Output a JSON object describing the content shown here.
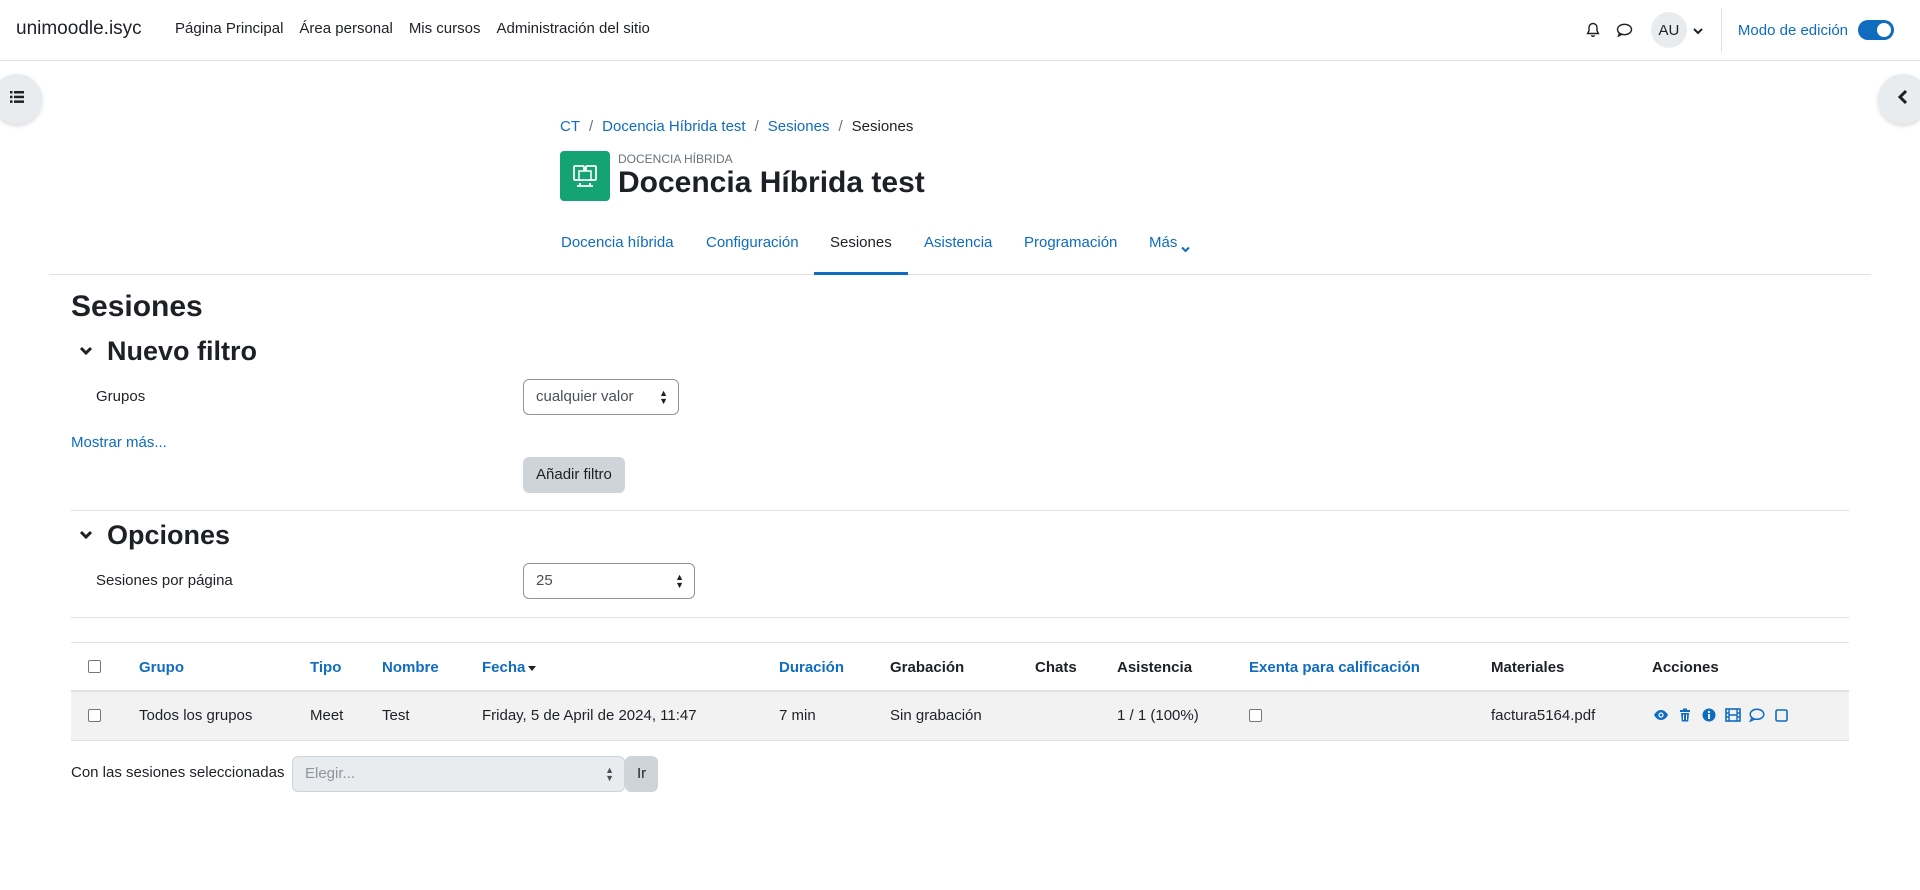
{
  "navbar": {
    "brand": "unimoodle.isyc",
    "links": [
      "Página Principal",
      "Área personal",
      "Mis cursos",
      "Administración del sitio"
    ],
    "user_initials": "AU",
    "edit_mode_label": "Modo de edición",
    "edit_mode_on": true
  },
  "breadcrumb": {
    "items": [
      "CT",
      "Docencia Híbrida test",
      "Sesiones"
    ],
    "current": "Sesiones"
  },
  "header": {
    "pretitle": "DOCENCIA HÍBRIDA",
    "title": "Docencia Híbrida test",
    "icon_color": "#16a374"
  },
  "secondary_nav": {
    "tabs": [
      "Docencia híbrida",
      "Configuración",
      "Sesiones",
      "Asistencia",
      "Programación",
      "Más"
    ],
    "active": "Sesiones"
  },
  "main": {
    "heading": "Sesiones",
    "filter": {
      "title": "Nuevo filtro",
      "groups_label": "Grupos",
      "groups_value": "cualquier valor",
      "show_more": "Mostrar más...",
      "add_filter": "Añadir filtro"
    },
    "options": {
      "title": "Opciones",
      "per_page_label": "Sesiones por página",
      "per_page_value": "25"
    },
    "table": {
      "headers": [
        "Grupo",
        "Tipo",
        "Nombre",
        "Fecha",
        "Duración",
        "Grabación",
        "Chats",
        "Asistencia",
        "Exenta para calificación",
        "Materiales",
        "Acciones"
      ],
      "rows": [
        {
          "grupo": "Todos los grupos",
          "tipo": "Meet",
          "nombre": "Test",
          "fecha": "Friday, 5 de April de 2024, 11:47",
          "duracion": "7 min",
          "grabacion": "Sin grabación",
          "chats": "",
          "asistencia": "1 / 1 (100%)",
          "exenta": false,
          "materiales": "factura5164.pdf",
          "acciones": [
            "eye-icon",
            "trash-icon",
            "info-icon",
            "film-icon",
            "comment-icon",
            "square-icon"
          ]
        }
      ]
    },
    "bulk": {
      "label": "Con las sesiones seleccionadas",
      "placeholder": "Elegir...",
      "go": "Ir"
    }
  },
  "colors": {
    "link": "#0f6cbf",
    "text": "#1d2125",
    "row_bg": "#f2f2f2"
  }
}
